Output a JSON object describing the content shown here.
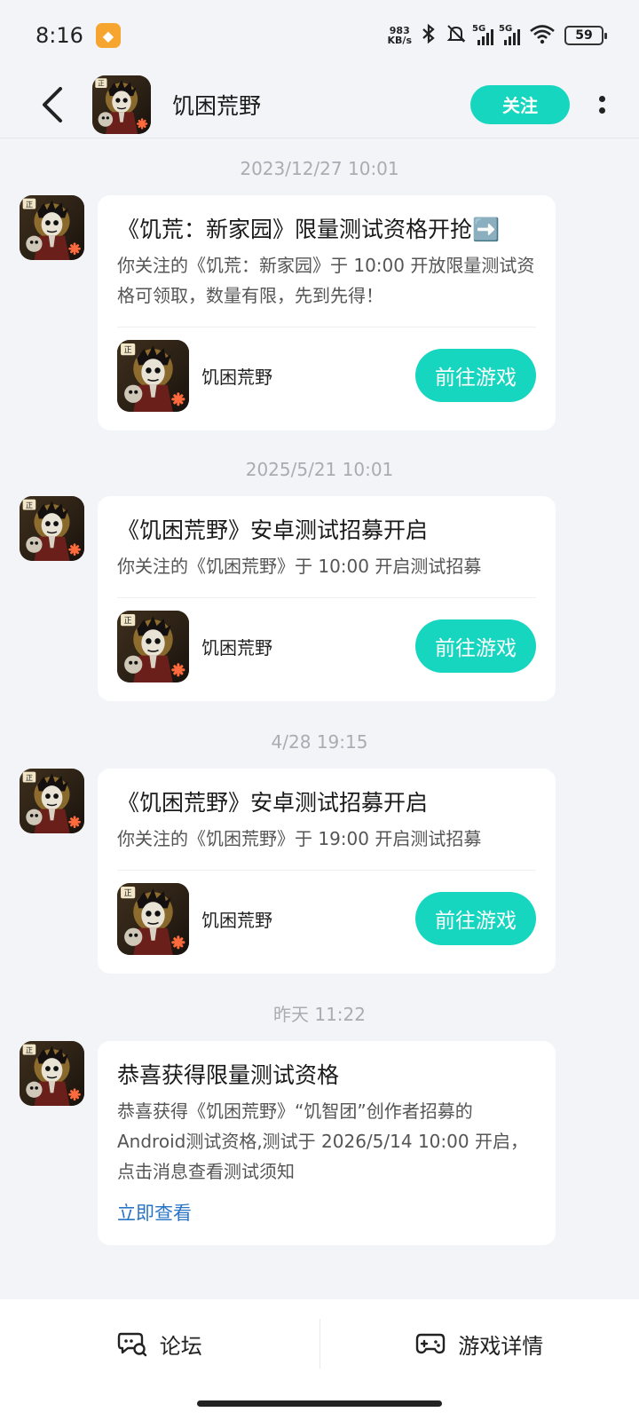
{
  "status_bar": {
    "time": "8:16",
    "net_speed_value": "983",
    "net_speed_unit": "KB/s",
    "signal_1": "5G",
    "signal_2": "5G",
    "battery": "59"
  },
  "header": {
    "title": "饥困荒野",
    "follow_label": "关注"
  },
  "messages": [
    {
      "timestamp": "2023/12/27  10:01",
      "title": "《饥荒：新家园》限量测试资格开抢➡️",
      "body": "你关注的《饥荒：新家园》于 10:00 开放限量测试资格可领取，数量有限，先到先得！",
      "game_name": "饥困荒野",
      "button": "前往游戏"
    },
    {
      "timestamp": "2025/5/21  10:01",
      "title": "《饥困荒野》安卓测试招募开启",
      "body": "你关注的《饥困荒野》于 10:00 开启测试招募",
      "game_name": "饥困荒野",
      "button": "前往游戏"
    },
    {
      "timestamp": "4/28  19:15",
      "title": "《饥困荒野》安卓测试招募开启",
      "body": "你关注的《饥困荒野》于 19:00 开启测试招募",
      "game_name": "饥困荒野",
      "button": "前往游戏"
    },
    {
      "timestamp": "昨天  11:22",
      "title": "恭喜获得限量测试资格",
      "body": "恭喜获得《饥困荒野》“饥智团”创作者招募的Android测试资格,测试于 2026/5/14 10:00 开启，点击消息查看测试须知",
      "link": "立即查看"
    }
  ],
  "bottom_nav": {
    "forum_label": "论坛",
    "details_label": "游戏详情"
  },
  "colors": {
    "accent": "#17d6c0",
    "link": "#2a74c5",
    "background": "#f3f4f8"
  }
}
